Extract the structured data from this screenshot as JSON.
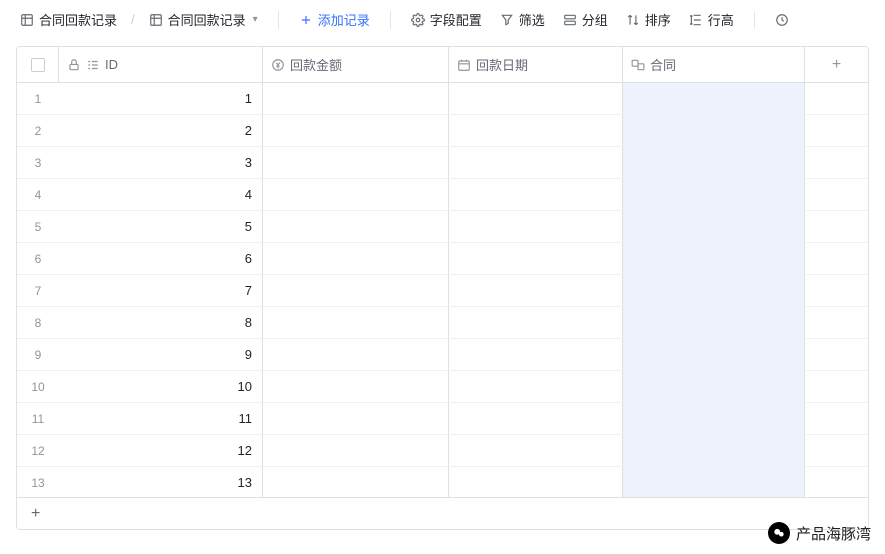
{
  "toolbar": {
    "breadcrumb1": "合同回款记录",
    "breadcrumb2": "合同回款记录",
    "add_record": "添加记录",
    "field_config": "字段配置",
    "filter": "筛选",
    "group": "分组",
    "sort": "排序",
    "row_height": "行高"
  },
  "columns": {
    "id": "ID",
    "amount": "回款金额",
    "date": "回款日期",
    "contract": "合同"
  },
  "rows": [
    {
      "n": "1",
      "id": "1"
    },
    {
      "n": "2",
      "id": "2"
    },
    {
      "n": "3",
      "id": "3"
    },
    {
      "n": "4",
      "id": "4"
    },
    {
      "n": "5",
      "id": "5"
    },
    {
      "n": "6",
      "id": "6"
    },
    {
      "n": "7",
      "id": "7"
    },
    {
      "n": "8",
      "id": "8"
    },
    {
      "n": "9",
      "id": "9"
    },
    {
      "n": "10",
      "id": "10"
    },
    {
      "n": "11",
      "id": "11"
    },
    {
      "n": "12",
      "id": "12"
    },
    {
      "n": "13",
      "id": "13"
    }
  ],
  "watermark": {
    "text": "产品海豚湾"
  }
}
